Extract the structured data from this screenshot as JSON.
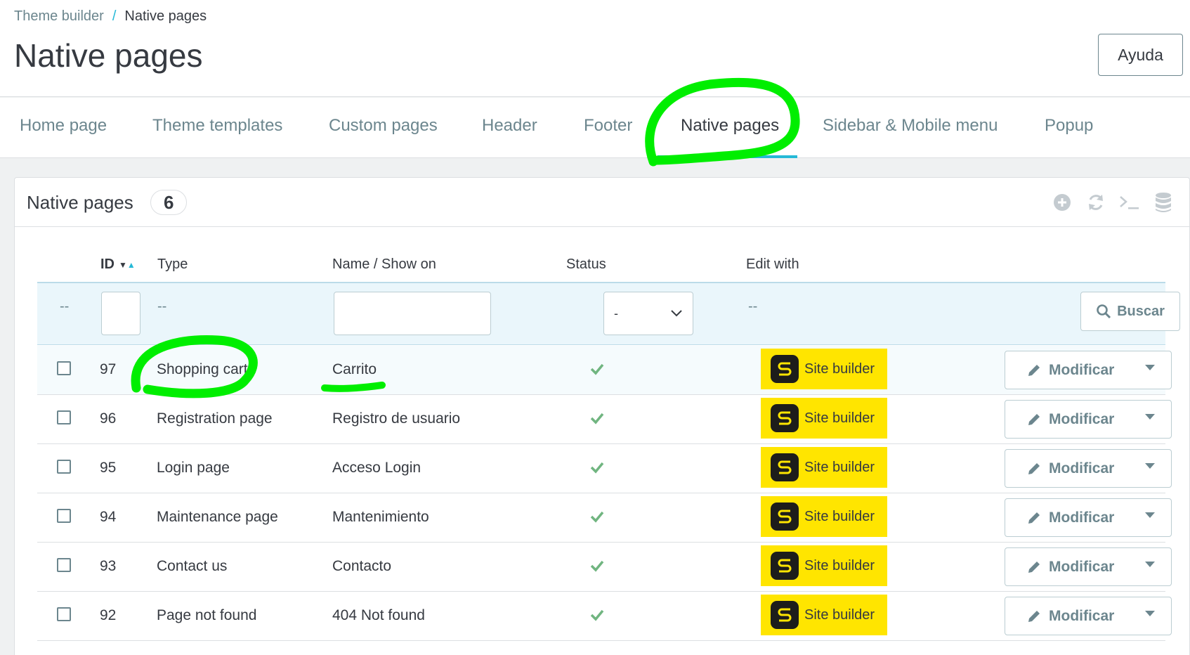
{
  "breadcrumb": {
    "parent": "Theme builder",
    "separator": "/",
    "current": "Native pages"
  },
  "page_title": "Native pages",
  "help_button": "Ayuda",
  "tabs": [
    {
      "label": "Home page",
      "active": false
    },
    {
      "label": "Theme templates",
      "active": false
    },
    {
      "label": "Custom pages",
      "active": false
    },
    {
      "label": "Header",
      "active": false
    },
    {
      "label": "Footer",
      "active": false
    },
    {
      "label": "Native pages",
      "active": true
    },
    {
      "label": "Sidebar & Mobile menu",
      "active": false
    },
    {
      "label": "Popup",
      "active": false
    }
  ],
  "panel": {
    "title": "Native pages",
    "count": "6",
    "icons": [
      "add-icon",
      "refresh-icon",
      "terminal-icon",
      "database-icon"
    ]
  },
  "table": {
    "columns": {
      "id": "ID",
      "type": "Type",
      "name": "Name / Show on",
      "status": "Status",
      "edit_with": "Edit with"
    },
    "filters": {
      "bulk": "--",
      "type": "--",
      "status_value": "-",
      "edit_with": "--",
      "search_button": "Buscar"
    },
    "rows": [
      {
        "id": "97",
        "type": "Shopping cart",
        "name": "Carrito",
        "status": "enabled",
        "edit_with": "Site builder",
        "action": "Modificar"
      },
      {
        "id": "96",
        "type": "Registration page",
        "name": "Registro de usuario",
        "status": "enabled",
        "edit_with": "Site builder",
        "action": "Modificar"
      },
      {
        "id": "95",
        "type": "Login page",
        "name": "Acceso Login",
        "status": "enabled",
        "edit_with": "Site builder",
        "action": "Modificar"
      },
      {
        "id": "94",
        "type": "Maintenance page",
        "name": "Mantenimiento",
        "status": "enabled",
        "edit_with": "Site builder",
        "action": "Modificar"
      },
      {
        "id": "93",
        "type": "Contact us",
        "name": "Contacto",
        "status": "enabled",
        "edit_with": "Site builder",
        "action": "Modificar"
      },
      {
        "id": "92",
        "type": "Page not found",
        "name": "404 Not found",
        "status": "enabled",
        "edit_with": "Site builder",
        "action": "Modificar"
      }
    ]
  },
  "colors": {
    "accent": "#25b9d7",
    "badge": "#ffe500",
    "check": "#70b580",
    "highlight_marker": "#00ee00"
  }
}
